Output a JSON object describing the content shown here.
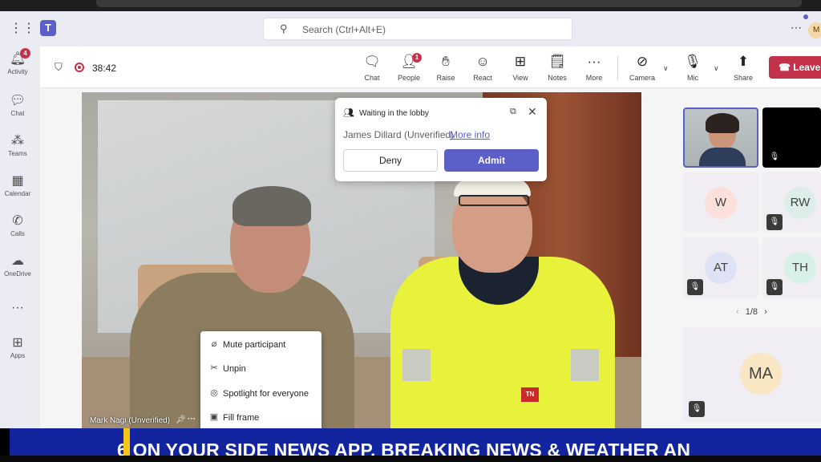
{
  "app": {
    "search_placeholder": "Search (Ctrl+Alt+E)",
    "user_initial": "M"
  },
  "rail": {
    "items": [
      {
        "label": "Activity",
        "icon": "bell-icon",
        "badge": "4"
      },
      {
        "label": "Chat",
        "icon": "chat-icon"
      },
      {
        "label": "Teams",
        "icon": "teams-icon"
      },
      {
        "label": "Calendar",
        "icon": "calendar-icon"
      },
      {
        "label": "Calls",
        "icon": "phone-icon"
      },
      {
        "label": "OneDrive",
        "icon": "cloud-icon"
      },
      {
        "label": "",
        "icon": "more-icon"
      },
      {
        "label": "Apps",
        "icon": "apps-icon"
      }
    ]
  },
  "meeting": {
    "timer": "38:42",
    "toolbar": {
      "chat": "Chat",
      "people": "People",
      "people_badge": "1",
      "raise": "Raise",
      "react": "React",
      "view": "View",
      "notes": "Notes",
      "more": "More",
      "camera": "Camera",
      "mic": "Mic",
      "share": "Share",
      "leave": "Leave"
    }
  },
  "lobby": {
    "title": "Waiting in the lobby",
    "person": "James Dillard (Unverified)",
    "more_info": "More info",
    "deny": "Deny",
    "admit": "Admit"
  },
  "video": {
    "name_tag": "Mark Nagi (Unverified)",
    "shirt_logo": "TN"
  },
  "context_menu": {
    "items": [
      {
        "label": "Mute participant",
        "icon": "mic-off-icon"
      },
      {
        "label": "Unpin",
        "icon": "unpin-icon"
      },
      {
        "label": "Spotlight for everyone",
        "icon": "spotlight-icon"
      },
      {
        "label": "Fill frame",
        "icon": "fill-frame-icon"
      }
    ]
  },
  "gallery": {
    "tiles": [
      {
        "initials": "W",
        "color": "#fde0dc"
      },
      {
        "initials": "RW",
        "color": "#dcedea"
      },
      {
        "initials": "AT",
        "color": "#dde3f5"
      },
      {
        "initials": "TH",
        "color": "#d8f1e6"
      },
      {
        "initials": "MA",
        "color": "#f8e7c2"
      }
    ],
    "pager": "1/8"
  },
  "ticker": {
    "text": "6 ON YOUR SIDE NEWS APP. BREAKING NEWS & WEATHER AN"
  },
  "colors": {
    "accent": "#5b5fc7",
    "leave": "#c4314b",
    "ticker": "#12259e"
  }
}
